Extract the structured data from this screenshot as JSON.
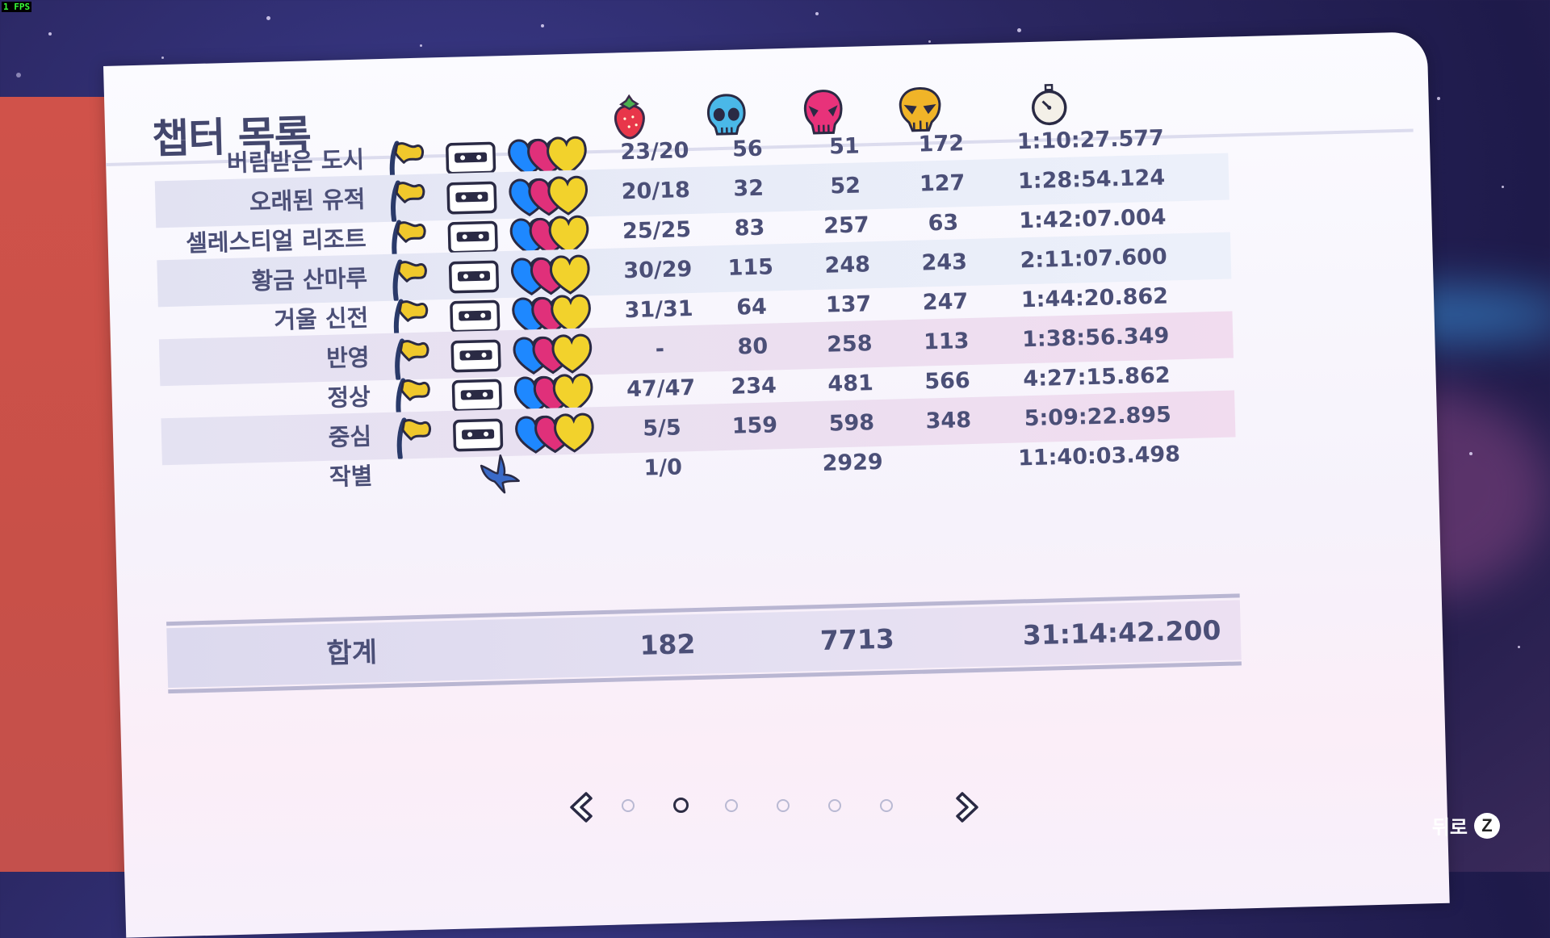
{
  "fps_label": "1 FPS",
  "title": "챕터 목록",
  "header_icons": [
    "strawberry-icon",
    "blue-skull-icon",
    "pink-skull-icon",
    "gold-skull-icon",
    "stopwatch-icon"
  ],
  "rows": [
    {
      "name": "버림받은 도시",
      "berries": "23/20",
      "deaths_a": "56",
      "deaths_b": "51",
      "deaths_c": "172",
      "time": "1:10:27.577"
    },
    {
      "name": "오래된 유적",
      "berries": "20/18",
      "deaths_a": "32",
      "deaths_b": "52",
      "deaths_c": "127",
      "time": "1:28:54.124"
    },
    {
      "name": "셀레스티얼 리조트",
      "berries": "25/25",
      "deaths_a": "83",
      "deaths_b": "257",
      "deaths_c": "63",
      "time": "1:42:07.004"
    },
    {
      "name": "황금 산마루",
      "berries": "30/29",
      "deaths_a": "115",
      "deaths_b": "248",
      "deaths_c": "243",
      "time": "2:11:07.600"
    },
    {
      "name": "거울 신전",
      "berries": "31/31",
      "deaths_a": "64",
      "deaths_b": "137",
      "deaths_c": "247",
      "time": "1:44:20.862"
    },
    {
      "name": "반영",
      "berries": "-",
      "deaths_a": "80",
      "deaths_b": "258",
      "deaths_c": "113",
      "time": "1:38:56.349"
    },
    {
      "name": "정상",
      "berries": "47/47",
      "deaths_a": "234",
      "deaths_b": "481",
      "deaths_c": "566",
      "time": "4:27:15.862"
    },
    {
      "name": "중심",
      "berries": "5/5",
      "deaths_a": "159",
      "deaths_b": "598",
      "deaths_c": "348",
      "time": "5:09:22.895"
    },
    {
      "name": "작별",
      "berries": "1/0",
      "deaths_a": "",
      "deaths_b": "2929",
      "deaths_c": "",
      "time": "11:40:03.498"
    }
  ],
  "total": {
    "label": "합계",
    "berries": "182",
    "deaths": "7713",
    "time": "31:14:42.200"
  },
  "pagination": {
    "pages": 6,
    "active": 2
  },
  "back_label": "뒤로",
  "back_key": "Z",
  "colors": {
    "text": "#4b4f77",
    "title": "#43476d",
    "flag": "#f0c82c",
    "heart_blue": "#1e88ff",
    "heart_pink": "#e0307a",
    "heart_gold": "#f2d22c"
  }
}
